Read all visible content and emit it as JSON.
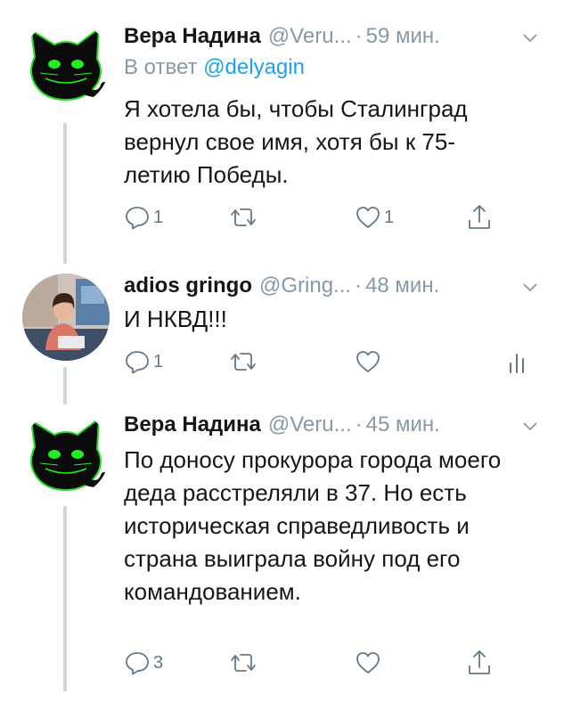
{
  "colors": {
    "accent": "#1da1f2",
    "secondary_text": "#8899a6",
    "icon": "#657786",
    "thread_line": "#ccd6dd"
  },
  "tweets": [
    {
      "author_name": "Вера Надина",
      "handle": "@Veru...",
      "separator": "·",
      "time": "59 мин.",
      "reply_prefix": "В ответ",
      "reply_mention": "@delyagin",
      "text": "Я хотела бы, чтобы Сталинград вернул свое имя, хотя бы к 75-летию Победы.",
      "reply_count": "1",
      "retweet_count": "",
      "like_count": "1",
      "last_action_icon": "share-icon"
    },
    {
      "author_name": "adios gringo",
      "handle": "@Gring...",
      "separator": "·",
      "time": "48 мин.",
      "text": "И НКВД!!!",
      "reply_count": "1",
      "retweet_count": "",
      "like_count": "",
      "last_action_icon": "analytics-icon"
    },
    {
      "author_name": "Вера Надина",
      "handle": "@Veru...",
      "separator": "·",
      "time": "45 мин.",
      "text": "По доносу прокурора города моего деда расстреляли в 37. Но есть историческая справедливость и страна выиграла войну под его командованием.",
      "reply_count": "3",
      "retweet_count": "",
      "like_count": "",
      "last_action_icon": "share-icon"
    }
  ]
}
